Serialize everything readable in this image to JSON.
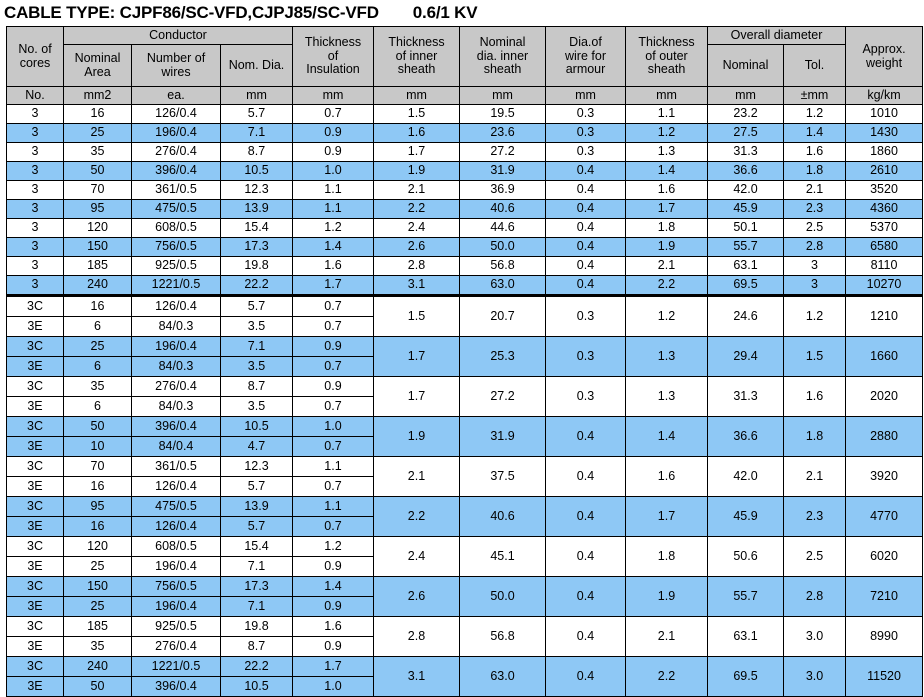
{
  "title": {
    "main": "CABLE TYPE: CJPF86/SC-VFD,CJPJ85/SC-VFD",
    "voltage": "0.6/1 KV"
  },
  "colors": {
    "header_bg": "#c8c8c8",
    "row_alt_bg": "#8ec8f5",
    "row_bg": "#ffffff",
    "border": "#000000"
  },
  "header": {
    "groups": {
      "no_of_cores": "No. of cores",
      "conductor": "Conductor",
      "thickness_insulation": "Thickness of Insulation",
      "thickness_inner_sheath": "Thickness of inner sheath",
      "nominal_dia_inner_sheath": "Nominal dia. inner sheath",
      "dia_wire_armour": "Dia.of wire for armour",
      "thickness_outer_sheath": "Thickness of outer sheath",
      "overall_diameter": "Overall diameter",
      "approx_weight": "Approx. weight"
    },
    "cores_line1": "No. of",
    "cores_line2": "cores",
    "conductor_sub": {
      "nominal_area_l1": "Nominal",
      "nominal_area_l2": "Area",
      "number_wires_l1": "Number of",
      "number_wires_l2": "wires",
      "nom_dia": "Nom. Dia."
    },
    "ins_l1": "Thickness",
    "ins_l2": "of",
    "ins_l3": "Insulation",
    "inner_l1": "Thickness",
    "inner_l2": "of inner",
    "inner_l3": "sheath",
    "nomdia_l1": "Nominal",
    "nomdia_l2": "dia. inner",
    "nomdia_l3": "sheath",
    "armour_l1": "Dia.of",
    "armour_l2": "wire for",
    "armour_l3": "armour",
    "outer_l1": "Thickness",
    "outer_l2": "of outer",
    "outer_l3": "sheath",
    "overall_nominal": "Nominal",
    "overall_tol": "Tol.",
    "weight_l1": "Approx.",
    "weight_l2": "weight"
  },
  "units": [
    "No.",
    "mm2",
    "ea.",
    "mm",
    "mm",
    "mm",
    "mm",
    "mm",
    "mm",
    "mm",
    "±mm",
    "kg/km"
  ],
  "section1": {
    "rows": [
      {
        "cores": "3",
        "area": "16",
        "wires": "126/0.4",
        "nomdia": "5.7",
        "ins": "0.7",
        "inner": "1.5",
        "nominner": "19.5",
        "armour": "0.3",
        "outer": "1.1",
        "ovnom": "23.2",
        "ovtol": "1.2",
        "weight": "1010"
      },
      {
        "cores": "3",
        "area": "25",
        "wires": "196/0.4",
        "nomdia": "7.1",
        "ins": "0.9",
        "inner": "1.6",
        "nominner": "23.6",
        "armour": "0.3",
        "outer": "1.2",
        "ovnom": "27.5",
        "ovtol": "1.4",
        "weight": "1430"
      },
      {
        "cores": "3",
        "area": "35",
        "wires": "276/0.4",
        "nomdia": "8.7",
        "ins": "0.9",
        "inner": "1.7",
        "nominner": "27.2",
        "armour": "0.3",
        "outer": "1.3",
        "ovnom": "31.3",
        "ovtol": "1.6",
        "weight": "1860"
      },
      {
        "cores": "3",
        "area": "50",
        "wires": "396/0.4",
        "nomdia": "10.5",
        "ins": "1.0",
        "inner": "1.9",
        "nominner": "31.9",
        "armour": "0.4",
        "outer": "1.4",
        "ovnom": "36.6",
        "ovtol": "1.8",
        "weight": "2610"
      },
      {
        "cores": "3",
        "area": "70",
        "wires": "361/0.5",
        "nomdia": "12.3",
        "ins": "1.1",
        "inner": "2.1",
        "nominner": "36.9",
        "armour": "0.4",
        "outer": "1.6",
        "ovnom": "42.0",
        "ovtol": "2.1",
        "weight": "3520"
      },
      {
        "cores": "3",
        "area": "95",
        "wires": "475/0.5",
        "nomdia": "13.9",
        "ins": "1.1",
        "inner": "2.2",
        "nominner": "40.6",
        "armour": "0.4",
        "outer": "1.7",
        "ovnom": "45.9",
        "ovtol": "2.3",
        "weight": "4360"
      },
      {
        "cores": "3",
        "area": "120",
        "wires": "608/0.5",
        "nomdia": "15.4",
        "ins": "1.2",
        "inner": "2.4",
        "nominner": "44.6",
        "armour": "0.4",
        "outer": "1.8",
        "ovnom": "50.1",
        "ovtol": "2.5",
        "weight": "5370"
      },
      {
        "cores": "3",
        "area": "150",
        "wires": "756/0.5",
        "nomdia": "17.3",
        "ins": "1.4",
        "inner": "2.6",
        "nominner": "50.0",
        "armour": "0.4",
        "outer": "1.9",
        "ovnom": "55.7",
        "ovtol": "2.8",
        "weight": "6580"
      },
      {
        "cores": "3",
        "area": "185",
        "wires": "925/0.5",
        "nomdia": "19.8",
        "ins": "1.6",
        "inner": "2.8",
        "nominner": "56.8",
        "armour": "0.4",
        "outer": "2.1",
        "ovnom": "63.1",
        "ovtol": "3",
        "weight": "8110"
      },
      {
        "cores": "3",
        "area": "240",
        "wires": "1221/0.5",
        "nomdia": "22.2",
        "ins": "1.7",
        "inner": "3.1",
        "nominner": "63.0",
        "armour": "0.4",
        "outer": "2.2",
        "ovnom": "69.5",
        "ovtol": "3",
        "weight": "10270"
      }
    ]
  },
  "section2": {
    "rows": [
      {
        "cores_c": "3C",
        "cores_e": "3E",
        "area_c": "16",
        "area_e": "6",
        "wires_c": "126/0.4",
        "wires_e": "84/0.3",
        "nomdia_c": "5.7",
        "nomdia_e": "3.5",
        "ins_c": "0.7",
        "ins_e": "0.7",
        "inner": "1.5",
        "nominner": "20.7",
        "armour": "0.3",
        "outer": "1.2",
        "ovnom": "24.6",
        "ovtol": "1.2",
        "weight": "1210"
      },
      {
        "cores_c": "3C",
        "cores_e": "3E",
        "area_c": "25",
        "area_e": "6",
        "wires_c": "196/0.4",
        "wires_e": "84/0.3",
        "nomdia_c": "7.1",
        "nomdia_e": "3.5",
        "ins_c": "0.9",
        "ins_e": "0.7",
        "inner": "1.7",
        "nominner": "25.3",
        "armour": "0.3",
        "outer": "1.3",
        "ovnom": "29.4",
        "ovtol": "1.5",
        "weight": "1660"
      },
      {
        "cores_c": "3C",
        "cores_e": "3E",
        "area_c": "35",
        "area_e": "6",
        "wires_c": "276/0.4",
        "wires_e": "84/0.3",
        "nomdia_c": "8.7",
        "nomdia_e": "3.5",
        "ins_c": "0.9",
        "ins_e": "0.7",
        "inner": "1.7",
        "nominner": "27.2",
        "armour": "0.3",
        "outer": "1.3",
        "ovnom": "31.3",
        "ovtol": "1.6",
        "weight": "2020"
      },
      {
        "cores_c": "3C",
        "cores_e": "3E",
        "area_c": "50",
        "area_e": "10",
        "wires_c": "396/0.4",
        "wires_e": "84/0.4",
        "nomdia_c": "10.5",
        "nomdia_e": "4.7",
        "ins_c": "1.0",
        "ins_e": "0.7",
        "inner": "1.9",
        "nominner": "31.9",
        "armour": "0.4",
        "outer": "1.4",
        "ovnom": "36.6",
        "ovtol": "1.8",
        "weight": "2880"
      },
      {
        "cores_c": "3C",
        "cores_e": "3E",
        "area_c": "70",
        "area_e": "16",
        "wires_c": "361/0.5",
        "wires_e": "126/0.4",
        "nomdia_c": "12.3",
        "nomdia_e": "5.7",
        "ins_c": "1.1",
        "ins_e": "0.7",
        "inner": "2.1",
        "nominner": "37.5",
        "armour": "0.4",
        "outer": "1.6",
        "ovnom": "42.0",
        "ovtol": "2.1",
        "weight": "3920"
      },
      {
        "cores_c": "3C",
        "cores_e": "3E",
        "area_c": "95",
        "area_e": "16",
        "wires_c": "475/0.5",
        "wires_e": "126/0.4",
        "nomdia_c": "13.9",
        "nomdia_e": "5.7",
        "ins_c": "1.1",
        "ins_e": "0.7",
        "inner": "2.2",
        "nominner": "40.6",
        "armour": "0.4",
        "outer": "1.7",
        "ovnom": "45.9",
        "ovtol": "2.3",
        "weight": "4770"
      },
      {
        "cores_c": "3C",
        "cores_e": "3E",
        "area_c": "120",
        "area_e": "25",
        "wires_c": "608/0.5",
        "wires_e": "196/0.4",
        "nomdia_c": "15.4",
        "nomdia_e": "7.1",
        "ins_c": "1.2",
        "ins_e": "0.9",
        "inner": "2.4",
        "nominner": "45.1",
        "armour": "0.4",
        "outer": "1.8",
        "ovnom": "50.6",
        "ovtol": "2.5",
        "weight": "6020"
      },
      {
        "cores_c": "3C",
        "cores_e": "3E",
        "area_c": "150",
        "area_e": "25",
        "wires_c": "756/0.5",
        "wires_e": "196/0.4",
        "nomdia_c": "17.3",
        "nomdia_e": "7.1",
        "ins_c": "1.4",
        "ins_e": "0.9",
        "inner": "2.6",
        "nominner": "50.0",
        "armour": "0.4",
        "outer": "1.9",
        "ovnom": "55.7",
        "ovtol": "2.8",
        "weight": "7210"
      },
      {
        "cores_c": "3C",
        "cores_e": "3E",
        "area_c": "185",
        "area_e": "35",
        "wires_c": "925/0.5",
        "wires_e": "276/0.4",
        "nomdia_c": "19.8",
        "nomdia_e": "8.7",
        "ins_c": "1.6",
        "ins_e": "0.9",
        "inner": "2.8",
        "nominner": "56.8",
        "armour": "0.4",
        "outer": "2.1",
        "ovnom": "63.1",
        "ovtol": "3.0",
        "weight": "8990"
      },
      {
        "cores_c": "3C",
        "cores_e": "3E",
        "area_c": "240",
        "area_e": "50",
        "wires_c": "1221/0.5",
        "wires_e": "396/0.4",
        "nomdia_c": "22.2",
        "nomdia_e": "10.5",
        "ins_c": "1.7",
        "ins_e": "1.0",
        "inner": "3.1",
        "nominner": "63.0",
        "armour": "0.4",
        "outer": "2.2",
        "ovnom": "69.5",
        "ovtol": "3.0",
        "weight": "11520"
      }
    ]
  }
}
